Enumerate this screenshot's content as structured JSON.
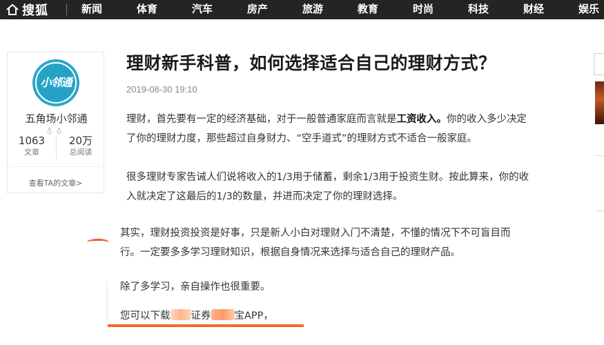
{
  "header": {
    "logo_text": "搜狐",
    "nav": [
      "新闻",
      "体育",
      "汽车",
      "房产",
      "旅游",
      "教育",
      "时尚",
      "科技",
      "财经",
      "娱乐"
    ]
  },
  "author": {
    "avatar_text": "小邻通",
    "name": "五角场小邻通",
    "articles_count": "1063",
    "articles_label": "文章",
    "reads_count": "20万",
    "reads_label": "总阅读",
    "more_link": "查看TA的文章>"
  },
  "article": {
    "title": "理财新手科普，如何选择适合自己的理财方式？",
    "date": "2019-08-30 19:10",
    "p1_line1_a": "理财，首先要有一定的经济基础，对于一般普通家庭而言就是",
    "p1_line1_bold": "工资收入。",
    "p1_line1_b": "你的收入多少决定",
    "p1_line2": "了你的理财力度，那些超过自身财力、“空手道式”的理财方式不适合一般家庭。",
    "p2_line1": "很多理财专家告诫人们说将收入的1/3用于储蓄，剩余1/3用于投资生财。按此算来，你的收",
    "p2_line2": "入就决定了这最后的1/3的数量，并进而决定了你的理财选择。",
    "p3_line1": "其实，理财投资投资是好事，只是新人小白对理财入门不清楚，不懂的情况下不可盲目而",
    "p3_line2": "行。一定要多多学习理财知识，根据自身情况来选择与适合自己的理财产品。",
    "p4": "除了多学习，亲自操作也很重要。",
    "p5_a": "您可以下载",
    "p5_b": "证券",
    "p5_c": "宝APP，"
  },
  "colors": {
    "nav_bg": "#242424",
    "accent": "#f26b2a",
    "avatar": "#2aa6c9"
  }
}
